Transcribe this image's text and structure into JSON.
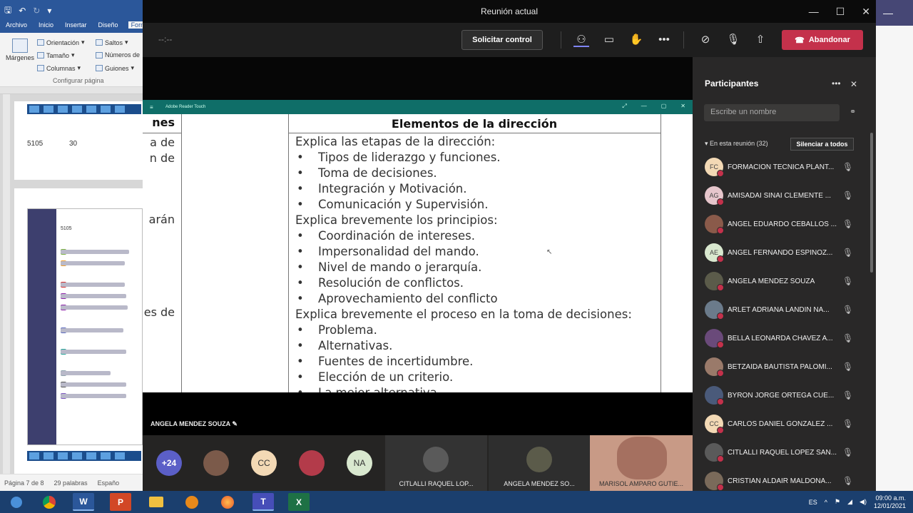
{
  "word": {
    "tabs": [
      "Archivo",
      "Inicio",
      "Insertar",
      "Diseño",
      "Form"
    ],
    "ribbon": {
      "margins": "Márgenes",
      "orientation": "Orientación",
      "size": "Tamaño",
      "columns": "Columnas",
      "breaks": "Saltos",
      "line_numbers": "Números de",
      "hyphenation": "Guiones",
      "group_label": "Configurar página"
    },
    "doc_values": [
      "5105",
      "30"
    ],
    "mini_title": "5105",
    "status": {
      "page": "Página 7 de 8",
      "words": "29 palabras",
      "lang": "Españo"
    }
  },
  "teams": {
    "window_title": "Reunión actual",
    "timer": "--:--",
    "request_control": "Solicitar control",
    "leave": "Abandonar",
    "share": {
      "app_title": "Adobe Reader Touch",
      "left_header_fragment": "nes",
      "left_fragments": [
        "a de",
        "n de",
        "arán",
        "es de"
      ],
      "heading": "Elementos de la dirección",
      "lines": [
        "Explica las etapas de la dirección:",
        "Tipos de liderazgo y funciones.",
        "Toma de decisiones.",
        "Integración y Motivación.",
        "Comunicación y Supervisión.",
        "Explica brevemente los principios:",
        "Coordinación de intereses.",
        "Impersonalidad del mando.",
        "Nivel de mando o jerarquía.",
        "Resolución de conflictos.",
        "Aprovechamiento del conflicto",
        "Explica brevemente el proceso en la toma de decisiones:",
        "Problema.",
        "Alternativas.",
        "Fuentes de incertidumbre.",
        "Elección de un criterio.",
        "La mejor alternativa"
      ]
    },
    "speaker_name": "ANGELA MENDEZ SOUZA",
    "strip": {
      "overflow": "+24",
      "initials": [
        "CC",
        "NA"
      ],
      "tiles": [
        "CITLALLI RAQUEL LOP...",
        "ANGELA MENDEZ SO...",
        "MARISOL AMPARO GUTIE..."
      ]
    },
    "panel": {
      "title": "Participantes",
      "search_placeholder": "Escribe un nombre",
      "in_meeting": "En esta reunión (32)",
      "mute_all": "Silenciar a todos",
      "participants": [
        {
          "initials": "FC",
          "name": "FORMACION TECNICA PLANT...",
          "color": "#f3d9b5"
        },
        {
          "initials": "AG",
          "name": "AMISADAI SINAI CLEMENTE ...",
          "color": "#e6c6cc"
        },
        {
          "initials": "",
          "name": "ANGEL EDUARDO CEBALLOS ...",
          "color": "#8a5a4a"
        },
        {
          "initials": "AE",
          "name": "ANGEL FERNANDO ESPINOZ...",
          "color": "#d9e8cf"
        },
        {
          "initials": "",
          "name": "ANGELA MENDEZ SOUZA",
          "color": "#5b5b4a"
        },
        {
          "initials": "",
          "name": "ARLET ADRIANA LANDIN NA...",
          "color": "#6b7b8b"
        },
        {
          "initials": "",
          "name": "BELLA LEONARDA CHAVEZ A...",
          "color": "#6a4a7a"
        },
        {
          "initials": "",
          "name": "BETZAIDA BAUTISTA PALOMI...",
          "color": "#9a7a6a"
        },
        {
          "initials": "",
          "name": "BYRON JORGE ORTEGA CUE...",
          "color": "#4a5a7a"
        },
        {
          "initials": "CC",
          "name": "CARLOS DANIEL GONZALEZ ...",
          "color": "#f3d9b5"
        },
        {
          "initials": "",
          "name": "CITLALLI RAQUEL LOPEZ SAN...",
          "color": "#5a5a5a"
        },
        {
          "initials": "",
          "name": "CRISTIAN ALDAIR MALDONA...",
          "color": "#7a6a5a"
        }
      ]
    }
  },
  "taskbar": {
    "lang": "ES",
    "time": "09:00 a.m.",
    "date": "12/01/2021"
  }
}
